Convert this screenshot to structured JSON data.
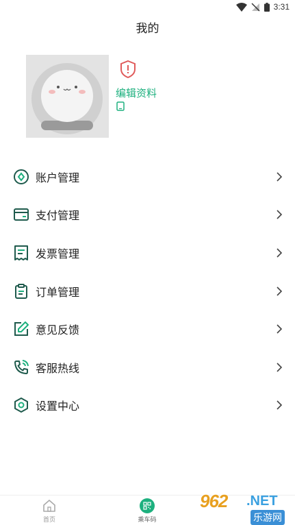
{
  "status_bar": {
    "time": "3:31"
  },
  "header": {
    "title": "我的"
  },
  "profile": {
    "edit_label": "编辑资料"
  },
  "menu": [
    {
      "label": "账户管理",
      "icon": "account-icon"
    },
    {
      "label": "支付管理",
      "icon": "payment-card-icon"
    },
    {
      "label": "发票管理",
      "icon": "invoice-icon"
    },
    {
      "label": "订单管理",
      "icon": "clipboard-icon"
    },
    {
      "label": "意见反馈",
      "icon": "edit-feedback-icon"
    },
    {
      "label": "客服热线",
      "icon": "phone-call-icon"
    },
    {
      "label": "设置中心",
      "icon": "settings-hexagon-icon"
    }
  ],
  "tabs": [
    {
      "label": "首页",
      "icon": "home-icon"
    },
    {
      "label": "乘车码",
      "icon": "qr-code-icon"
    }
  ],
  "watermark": {
    "number": "962",
    "domain": ".NET",
    "cn": "乐游网"
  },
  "colors": {
    "accent": "#1db07e",
    "icon_dark": "#1e5a4c",
    "warning": "#e05a5a"
  }
}
